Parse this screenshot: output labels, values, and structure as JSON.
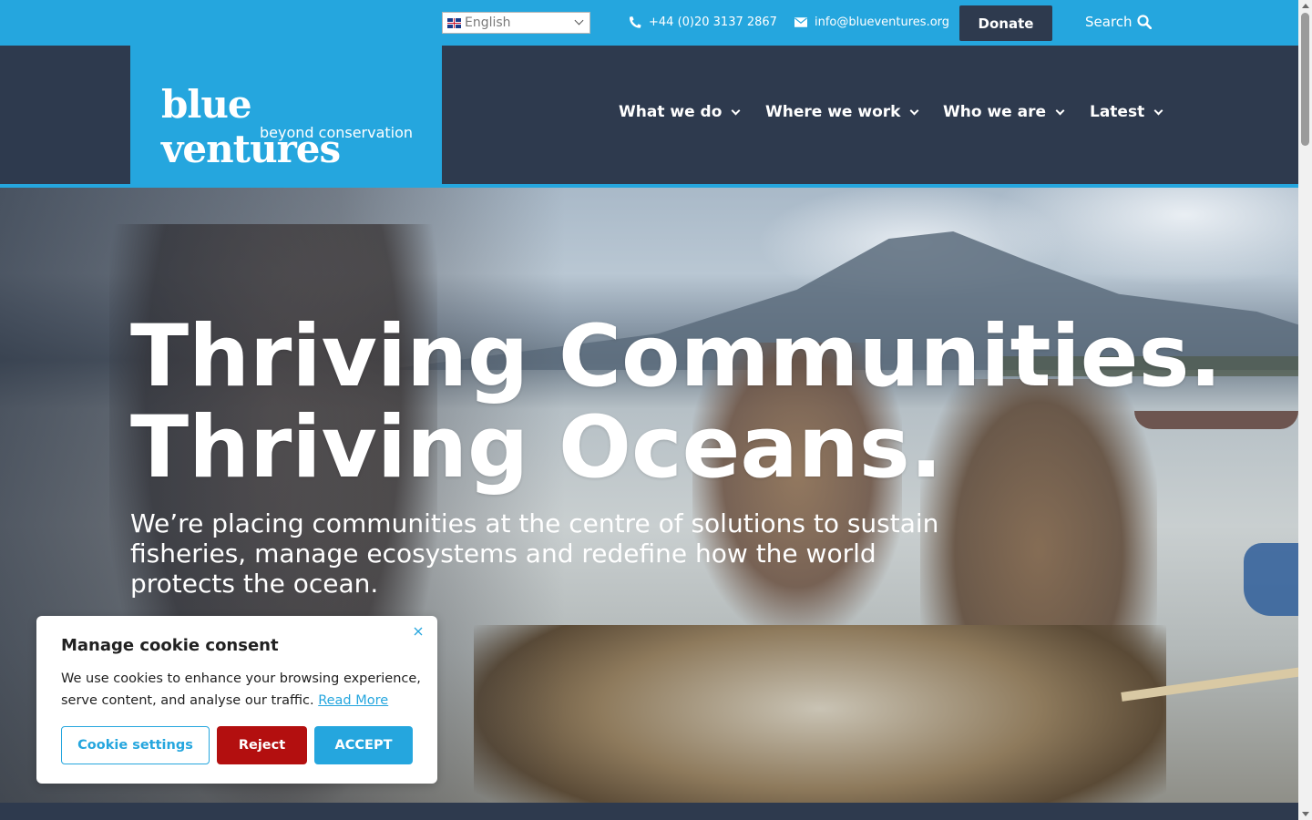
{
  "topbar": {
    "language": "English",
    "phone": "+44 (0)20 3137 2867",
    "email": "info@blueventures.org",
    "donate_label": "Donate",
    "search_label": "Search"
  },
  "header": {
    "logo_main": "blue ventures",
    "logo_sub": "beyond conservation",
    "nav": [
      {
        "label": "What we do"
      },
      {
        "label": "Where we work"
      },
      {
        "label": "Who we are"
      },
      {
        "label": "Latest"
      }
    ]
  },
  "hero": {
    "title_line1": "Thriving Communities.",
    "title_line2": "Thriving Oceans.",
    "subtitle": "We’re placing communities at the centre of solutions to sustain fisheries, manage ecosystems and redefine how the world protects the ocean."
  },
  "cookie": {
    "title": "Manage cookie consent",
    "text": "We use cookies to enhance your browsing experience, serve content, and analyse our traffic.",
    "read_more": "Read More",
    "settings_label": "Cookie settings",
    "reject_label": "Reject",
    "accept_label": "ACCEPT"
  },
  "colors": {
    "brand_blue": "#25a6de",
    "navy": "#2e3a4e",
    "reject_red": "#b30f0f"
  },
  "icons": {
    "phone": "phone-icon",
    "email": "envelope-icon",
    "search": "search-icon",
    "close": "close-icon",
    "dropdown": "chevron-down-icon",
    "flag": "uk-flag-icon"
  }
}
